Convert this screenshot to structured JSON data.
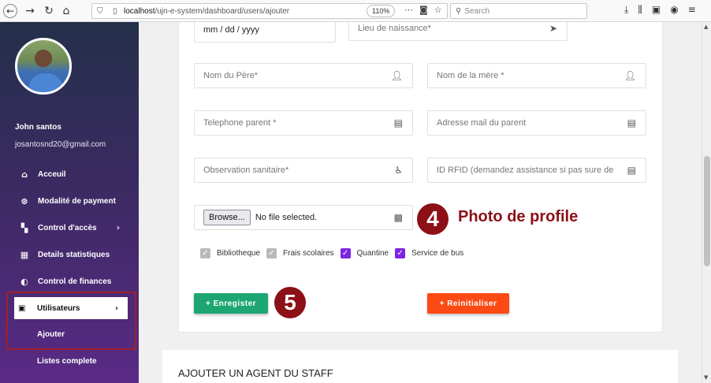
{
  "browser": {
    "url_scheme_host": "localhost",
    "url_path": "/ujn-e-system/dashboard/users/ajouter",
    "zoom": "110%",
    "search_placeholder": "Search"
  },
  "sidebar": {
    "user_name": "John santos",
    "user_email": "josantosnd20@gmail.com",
    "items": [
      {
        "label": "Acceuil",
        "icon": "home-icon"
      },
      {
        "label": "Modalité de payment",
        "icon": "payment-icon"
      },
      {
        "label": "Control d'accès",
        "icon": "access-icon"
      },
      {
        "label": "Details statistiques",
        "icon": "stats-icon"
      },
      {
        "label": "Control de finances",
        "icon": "finance-icon"
      }
    ],
    "active": {
      "label": "Utilisateurs",
      "icon": "users-icon"
    },
    "submenu": [
      "Ajouter",
      "Listes complete"
    ]
  },
  "form": {
    "date_value": "mm / dd / yyyy",
    "birthplace_placeholder": "Lieu de naissance*",
    "father_placeholder": "Nom du Père*",
    "mother_placeholder": "Nom de la mère *",
    "parent_phone_placeholder": "Telephone parent *",
    "parent_email_placeholder": "Adresse mail du parent",
    "health_placeholder": "Observation sanitaire*",
    "rfid_placeholder": "ID RFID (demandez assistance si pas sure de",
    "file_button": "Browse...",
    "file_status": "No file selected.",
    "checkboxes": [
      {
        "label": "Bibliotheque",
        "checked": false
      },
      {
        "label": "Frais scolaires",
        "checked": false
      },
      {
        "label": "Quantine",
        "checked": true
      },
      {
        "label": "Service de bus",
        "checked": true
      }
    ],
    "submit_label": "+ Enregister",
    "reset_label": "+ Reinitialiser"
  },
  "annotations": {
    "step4": "4",
    "step4_label": "Photo de profile",
    "step5": "5"
  },
  "section_title": "AJOUTER UN AGENT DU STAFF",
  "colors": {
    "accent_purple": "#7b26e0",
    "save_green": "#1ea672",
    "reset_orange": "#fb4a14",
    "annotation_red": "#8c1016"
  }
}
